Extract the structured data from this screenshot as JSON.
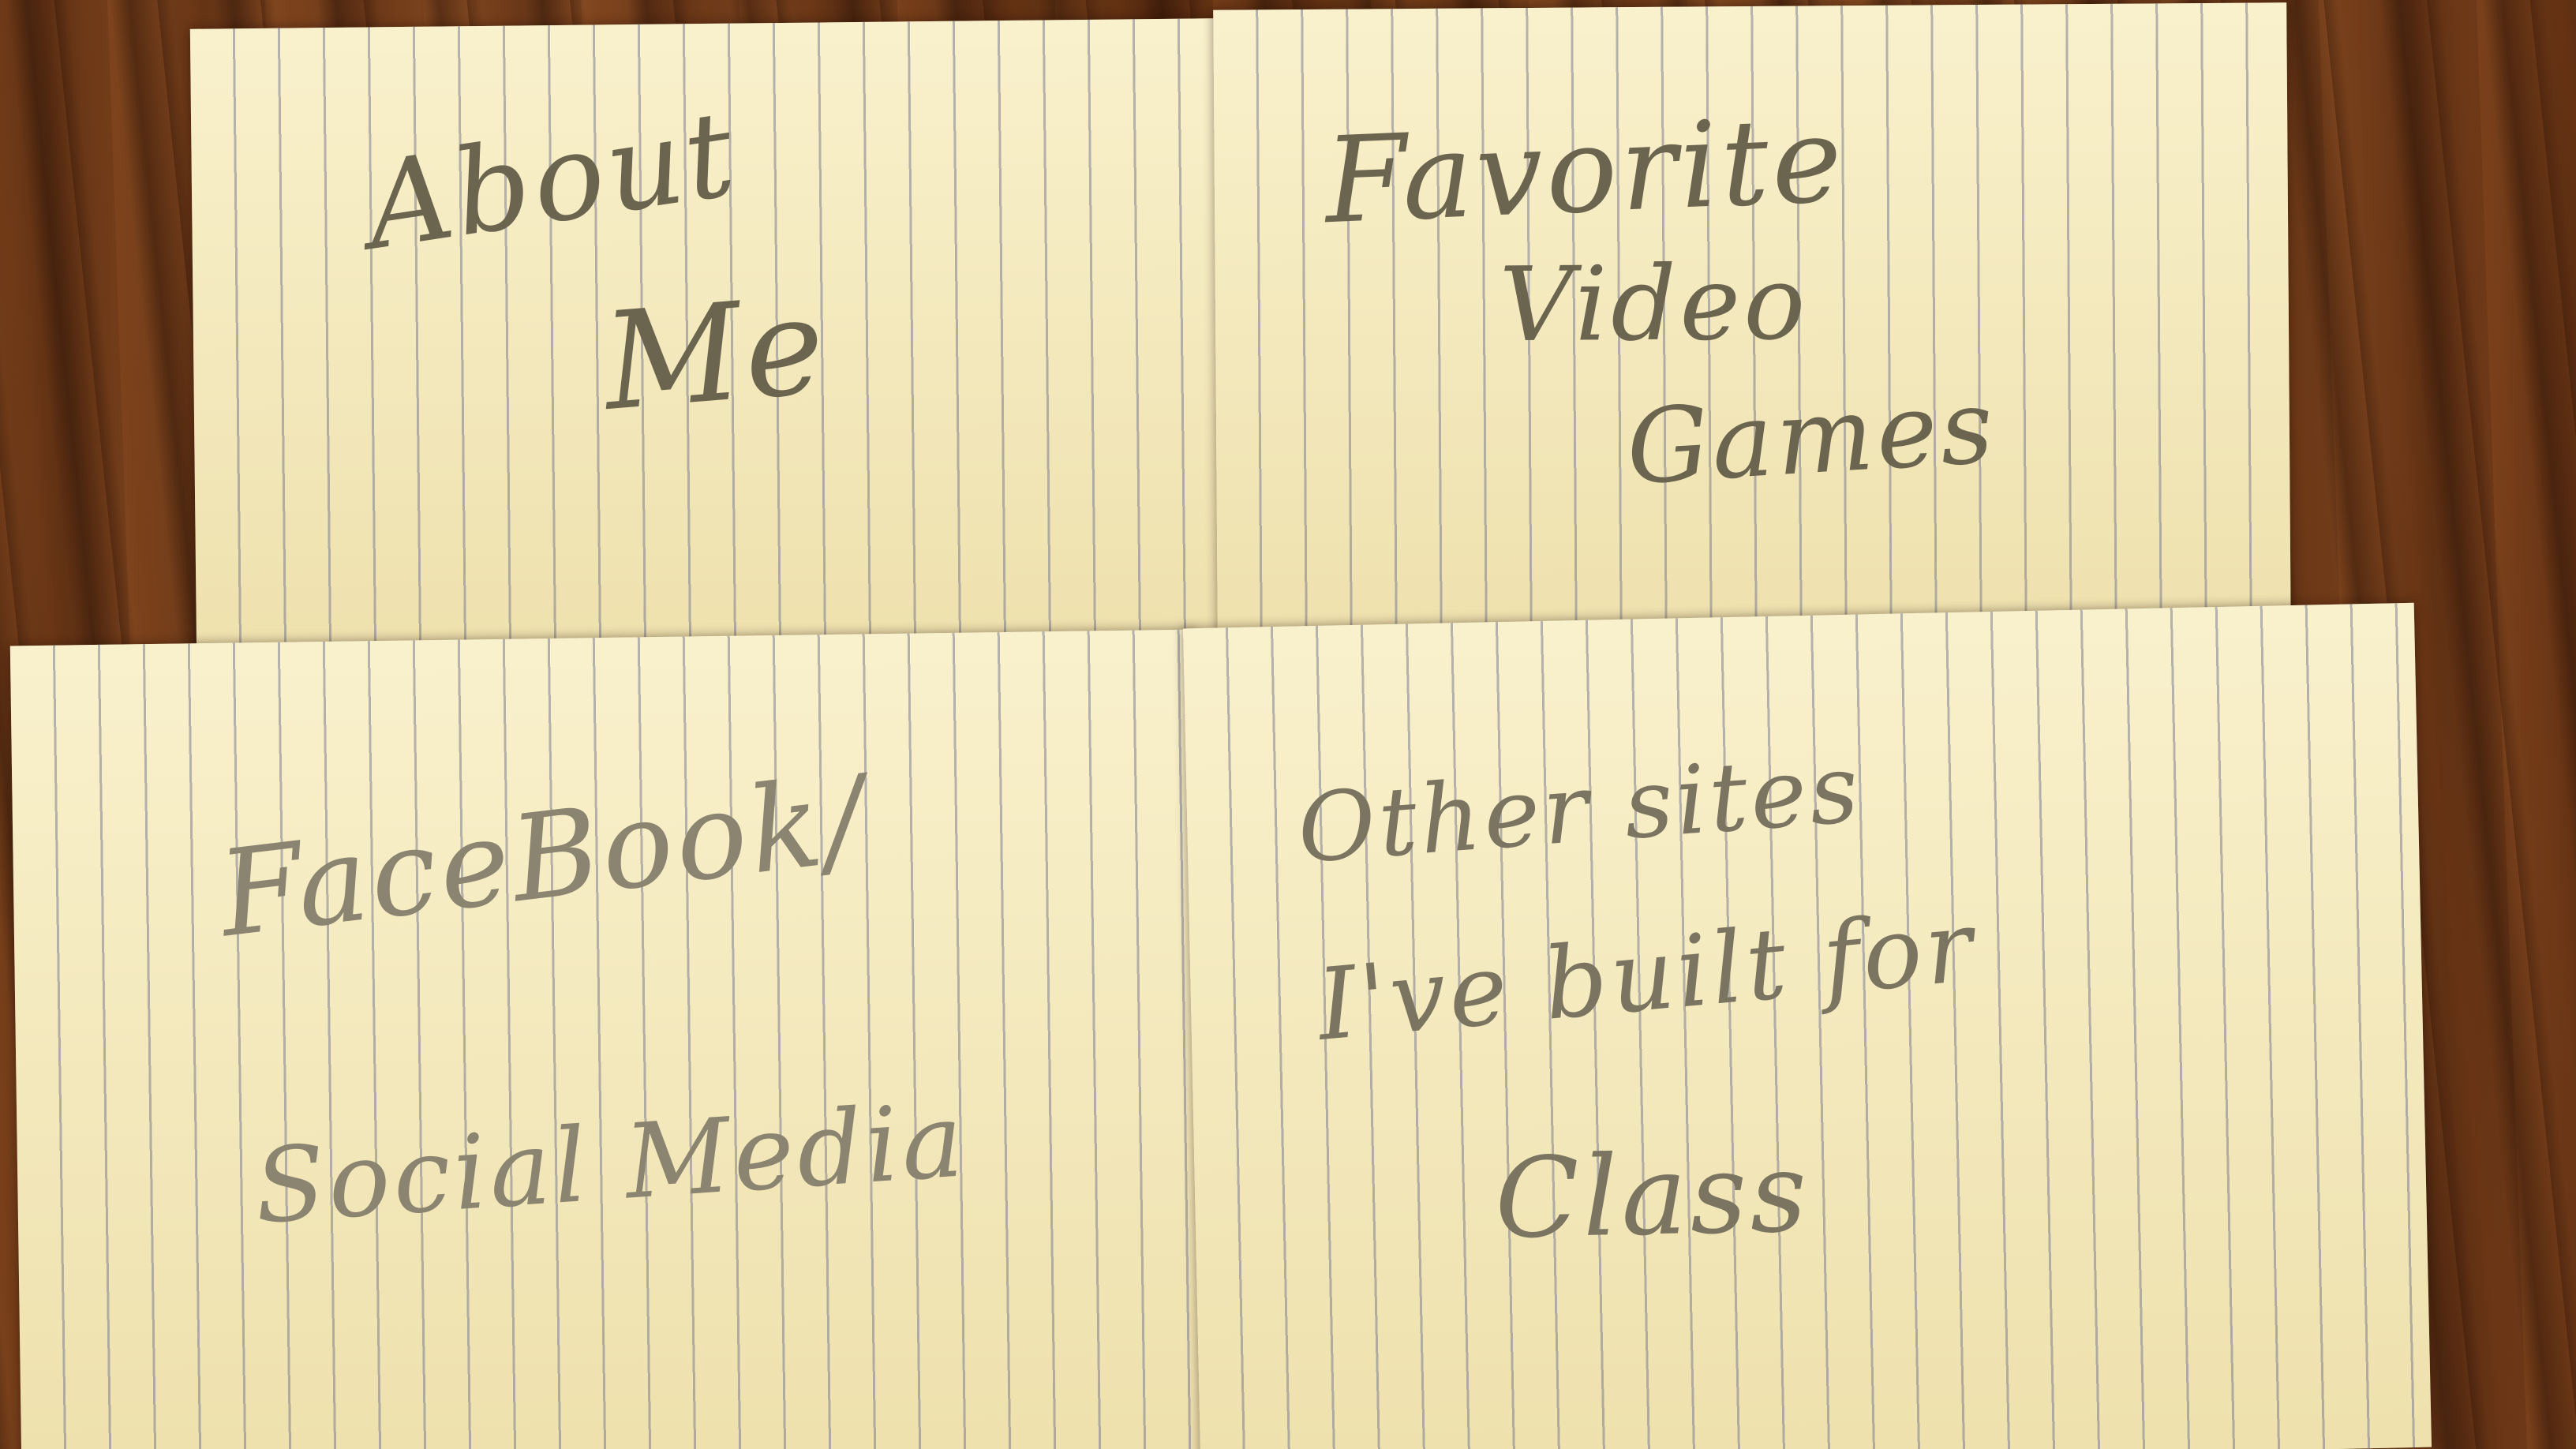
{
  "cards": {
    "about": {
      "line1": "About",
      "line2": "Me"
    },
    "games": {
      "line1": "Favorite",
      "line2": "Video",
      "line3": "Games"
    },
    "social": {
      "line1": "FaceBook/",
      "line2": "Social Media"
    },
    "sites": {
      "line1": "Other sites",
      "line2": "I've built for",
      "line3": "Class"
    }
  }
}
